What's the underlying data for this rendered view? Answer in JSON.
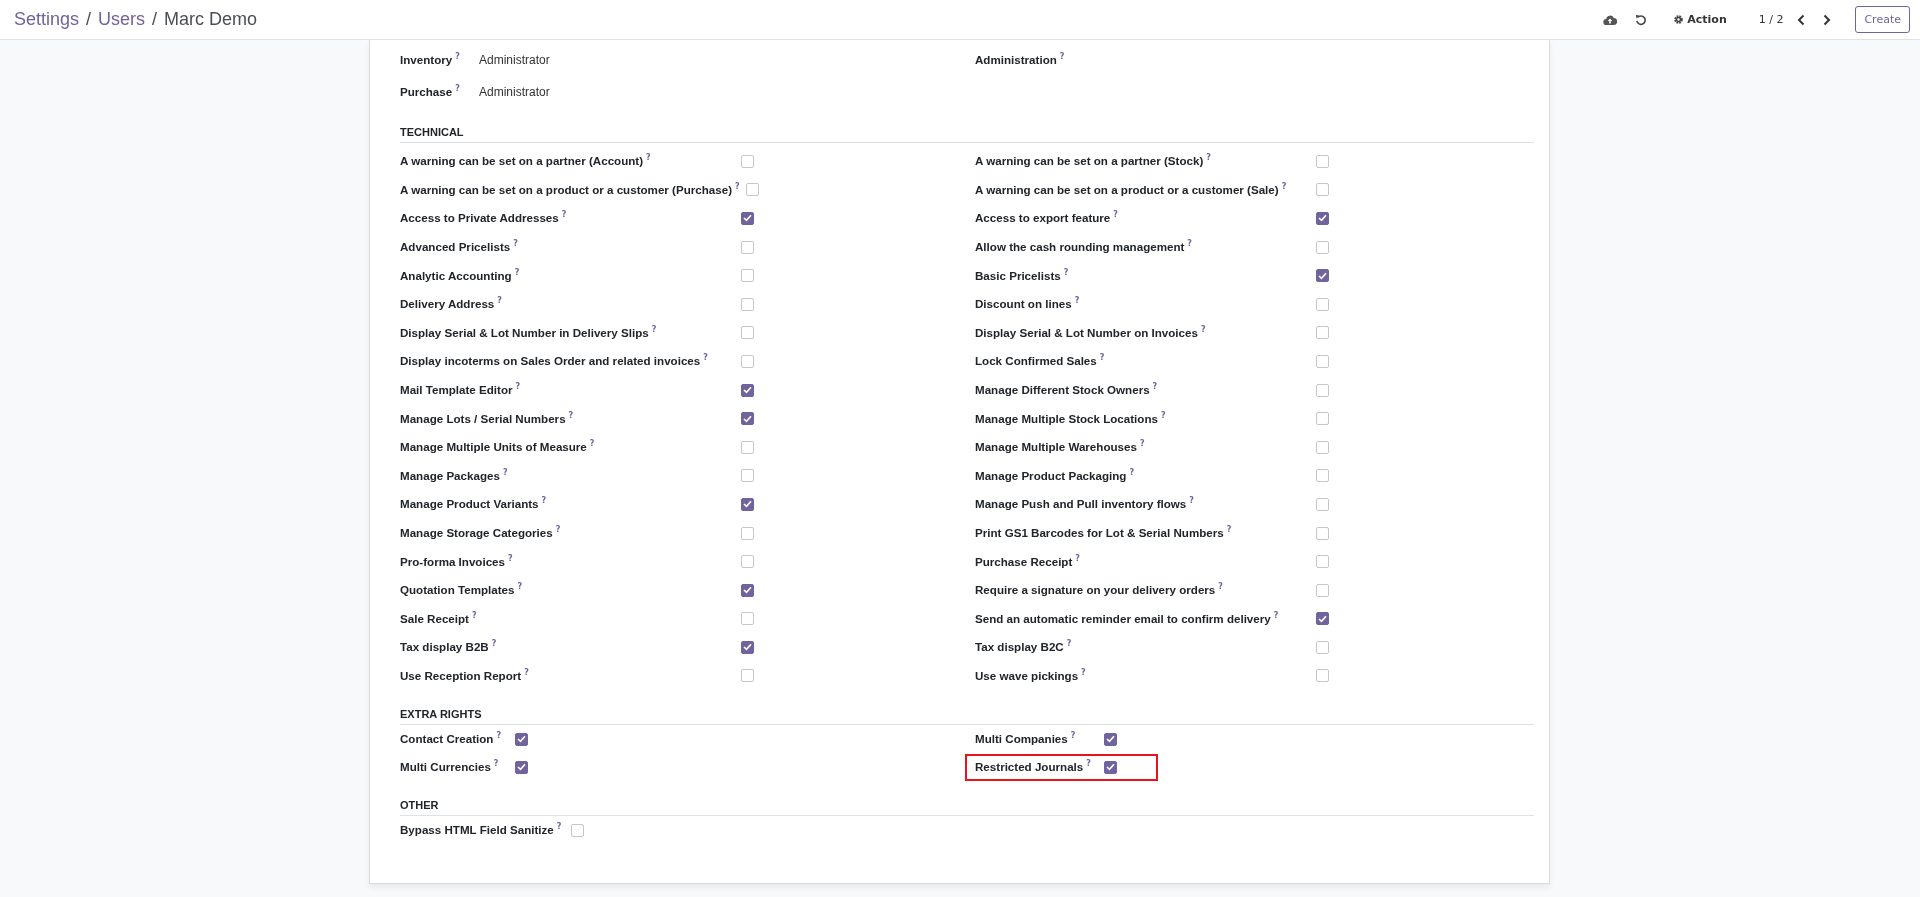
{
  "breadcrumb": [
    {
      "label": "Settings",
      "kind": "link"
    },
    {
      "label": "/",
      "kind": "separator"
    },
    {
      "label": "Users",
      "kind": "link"
    },
    {
      "label": "/",
      "kind": "separator"
    },
    {
      "label": "Marc Demo",
      "kind": "current"
    }
  ],
  "toolbar": {
    "action": "Action",
    "pager": "1 / 2",
    "create": "Create"
  },
  "access_rights": [
    {
      "label": "Inventory",
      "help": "?",
      "value": "Administrator"
    },
    {
      "label": "Administration",
      "help": "?"
    },
    {
      "label": "Purchase",
      "help": "?",
      "value": "Administrator"
    }
  ],
  "sections": [
    {
      "title": "TECHNICAL",
      "kind": "wide",
      "items": [
        {
          "label": "A warning can be set on a partner (Account)",
          "help": "?",
          "checked": false
        },
        {
          "label": "A warning can be set on a partner (Stock)",
          "help": "?",
          "checked": false
        },
        {
          "label": "A warning can be set on a product or a customer (Purchase)",
          "help": "?",
          "checked": false
        },
        {
          "label": "A warning can be set on a product or a customer (Sale)",
          "help": "?",
          "checked": false
        },
        {
          "label": "Access to Private Addresses",
          "help": "?",
          "checked": true
        },
        {
          "label": "Access to export feature",
          "help": "?",
          "checked": true
        },
        {
          "label": "Advanced Pricelists",
          "help": "?",
          "checked": false
        },
        {
          "label": "Allow the cash rounding management",
          "help": "?",
          "checked": false
        },
        {
          "label": "Analytic Accounting",
          "help": "?",
          "checked": false
        },
        {
          "label": "Basic Pricelists",
          "help": "?",
          "checked": true
        },
        {
          "label": "Delivery Address",
          "help": "?",
          "checked": false
        },
        {
          "label": "Discount on lines",
          "help": "?",
          "checked": false
        },
        {
          "label": "Display Serial & Lot Number in Delivery Slips",
          "help": "?",
          "checked": false
        },
        {
          "label": "Display Serial & Lot Number on Invoices",
          "help": "?",
          "checked": false
        },
        {
          "label": "Display incoterms on Sales Order and related invoices",
          "help": "?",
          "checked": false
        },
        {
          "label": "Lock Confirmed Sales",
          "help": "?",
          "checked": false
        },
        {
          "label": "Mail Template Editor",
          "help": "?",
          "checked": true
        },
        {
          "label": "Manage Different Stock Owners",
          "help": "?",
          "checked": false
        },
        {
          "label": "Manage Lots / Serial Numbers",
          "help": "?",
          "checked": true
        },
        {
          "label": "Manage Multiple Stock Locations",
          "help": "?",
          "checked": false
        },
        {
          "label": "Manage Multiple Units of Measure",
          "help": "?",
          "checked": false
        },
        {
          "label": "Manage Multiple Warehouses",
          "help": "?",
          "checked": false
        },
        {
          "label": "Manage Packages",
          "help": "?",
          "checked": false
        },
        {
          "label": "Manage Product Packaging",
          "help": "?",
          "checked": false
        },
        {
          "label": "Manage Product Variants",
          "help": "?",
          "checked": true
        },
        {
          "label": "Manage Push and Pull inventory flows",
          "help": "?",
          "checked": false
        },
        {
          "label": "Manage Storage Categories",
          "help": "?",
          "checked": false
        },
        {
          "label": "Print GS1 Barcodes for Lot & Serial Numbers",
          "help": "?",
          "checked": false
        },
        {
          "label": "Pro-forma Invoices",
          "help": "?",
          "checked": false
        },
        {
          "label": "Purchase Receipt",
          "help": "?",
          "checked": false
        },
        {
          "label": "Quotation Templates",
          "help": "?",
          "checked": true
        },
        {
          "label": "Require a signature on your delivery orders",
          "help": "?",
          "checked": false
        },
        {
          "label": "Sale Receipt",
          "help": "?",
          "checked": false
        },
        {
          "label": "Send an automatic reminder email to confirm delivery",
          "help": "?",
          "checked": true
        },
        {
          "label": "Tax display B2B",
          "help": "?",
          "checked": true
        },
        {
          "label": "Tax display B2C",
          "help": "?",
          "checked": false
        },
        {
          "label": "Use Reception Report",
          "help": "?",
          "checked": false
        },
        {
          "label": "Use wave pickings",
          "help": "?",
          "checked": false
        }
      ]
    },
    {
      "title": "EXTRA RIGHTS",
      "kind": "narrow",
      "items": [
        {
          "label": "Contact Creation",
          "help": "?",
          "checked": true,
          "highlighted": false
        },
        {
          "label": "Multi Companies",
          "help": "?",
          "checked": true,
          "highlighted": false
        },
        {
          "label": "Multi Currencies",
          "help": "?",
          "checked": true,
          "highlighted": false
        },
        {
          "label": "Restricted Journals",
          "help": "?",
          "checked": true,
          "highlighted": true
        }
      ]
    },
    {
      "title": "OTHER",
      "kind": "narrow",
      "items": [
        {
          "label": "Bypass HTML Field Sanitize",
          "help": "?",
          "checked": false
        }
      ]
    }
  ]
}
